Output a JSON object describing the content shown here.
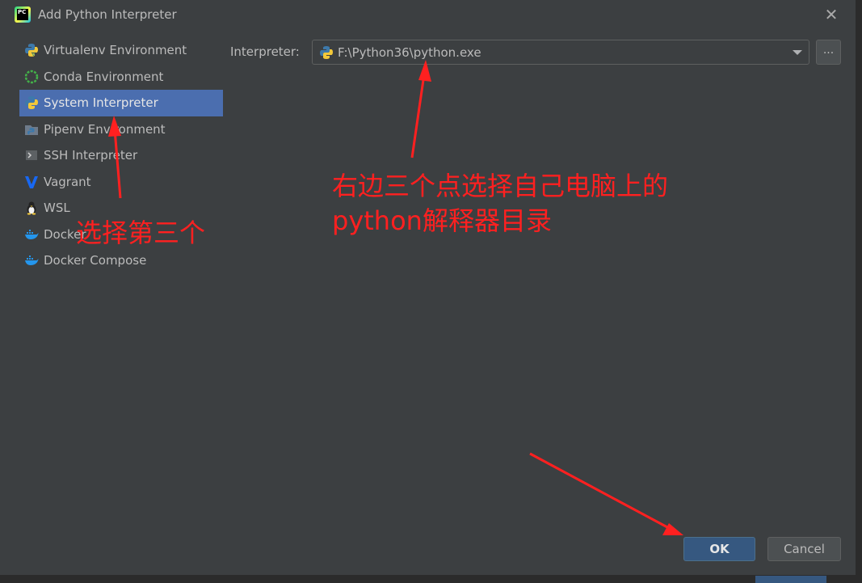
{
  "window": {
    "title": "Add Python Interpreter"
  },
  "sidebar": {
    "items": [
      {
        "label": "Virtualenv Environment",
        "icon": "python-virtualenv-icon",
        "selected": false
      },
      {
        "label": "Conda Environment",
        "icon": "conda-icon",
        "selected": false
      },
      {
        "label": "System Interpreter",
        "icon": "python-icon",
        "selected": true
      },
      {
        "label": "Pipenv Environment",
        "icon": "pipenv-icon",
        "selected": false
      },
      {
        "label": "SSH Interpreter",
        "icon": "ssh-terminal-icon",
        "selected": false
      },
      {
        "label": "Vagrant",
        "icon": "vagrant-icon",
        "selected": false
      },
      {
        "label": "WSL",
        "icon": "linux-penguin-icon",
        "selected": false
      },
      {
        "label": "Docker",
        "icon": "docker-whale-icon",
        "selected": false
      },
      {
        "label": "Docker Compose",
        "icon": "docker-compose-icon",
        "selected": false
      }
    ]
  },
  "form": {
    "interpreter_label": "Interpreter:",
    "interpreter_value": "F:\\Python36\\python.exe",
    "browse_label": "..."
  },
  "buttons": {
    "ok": "OK",
    "cancel": "Cancel"
  },
  "annotations": {
    "left_note": "选择第三个",
    "right_note_line1": "右边三个点选择自己电脑上的",
    "right_note_line2": "python解释器目录"
  },
  "colors": {
    "dialog_bg": "#3c3f41",
    "selection": "#4b6eaf",
    "ok_button": "#365880",
    "annotation_red": "#ff2020"
  }
}
